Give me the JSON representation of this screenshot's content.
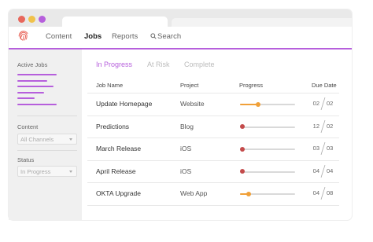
{
  "colors": {
    "accent": "#b65fdc",
    "red": "#e8675c",
    "yellow": "#f0c24b",
    "purple": "#b65fdc",
    "orange": "#f0a038",
    "muted_red": "#c44b4b"
  },
  "nav": {
    "items": [
      "Content",
      "Jobs",
      "Reports"
    ],
    "active": "Jobs",
    "search_label": "Search"
  },
  "sidebar": {
    "active_jobs_label": "Active Jobs",
    "content_label": "Content",
    "content_value": "All Channels",
    "status_label": "Status",
    "status_value": "In Progress"
  },
  "filters": {
    "tabs": [
      "In Progress",
      "At Risk",
      "Complete"
    ],
    "active": "In Progress"
  },
  "table": {
    "columns": [
      "Job Name",
      "Project",
      "Progress",
      "Due Date"
    ],
    "rows": [
      {
        "name": "Update Homepage",
        "project": "Website",
        "progress": 0.33,
        "due_month": "02",
        "due_day": "02"
      },
      {
        "name": "Predictions",
        "project": "Blog",
        "progress": 0.0,
        "due_month": "12",
        "due_day": "02"
      },
      {
        "name": "March Release",
        "project": "iOS",
        "progress": 0.0,
        "due_month": "03",
        "due_day": "03"
      },
      {
        "name": "April Release",
        "project": "iOS",
        "progress": 0.0,
        "due_month": "04",
        "due_day": "04"
      },
      {
        "name": "OKTA Upgrade",
        "project": "Web App",
        "progress": 0.15,
        "due_month": "04",
        "due_day": "08"
      }
    ]
  }
}
